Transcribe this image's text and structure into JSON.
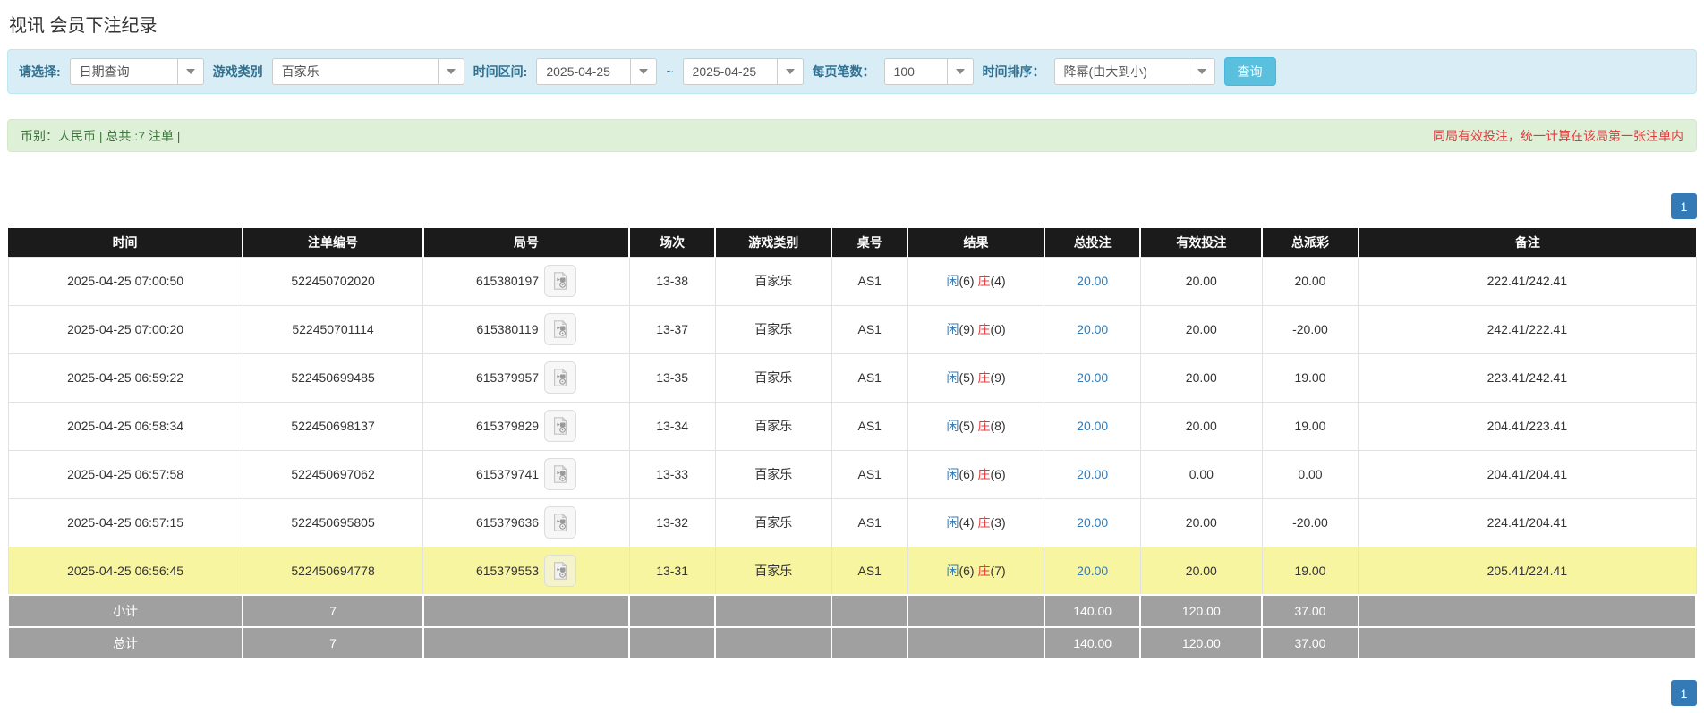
{
  "page": {
    "title": "视讯 会员下注纪录"
  },
  "filters": {
    "select_label": "请选择:",
    "select_value": "日期查询",
    "game_type_label": "游戏类别",
    "game_type_value": "百家乐",
    "time_range_label": "时间区间:",
    "date_from": "2025-04-25",
    "tilde": "~",
    "date_to": "2025-04-25",
    "per_page_label": "每页笔数：",
    "per_page_value": "100",
    "sort_label": "时间排序：",
    "sort_value": "降幂(由大到小)",
    "search_button": "查询"
  },
  "summary_bar": {
    "left_text": "币别：人民币 | 总共 :7 注单 |",
    "right_notice": "同局有效投注，统一计算在该局第一张注单内"
  },
  "pagination": {
    "page": "1"
  },
  "table": {
    "headers": [
      "时间",
      "注单编号",
      "局号",
      "场次",
      "游戏类别",
      "桌号",
      "结果",
      "总投注",
      "有效投注",
      "总派彩",
      "备注"
    ],
    "rows": [
      {
        "time": "2025-04-25 07:00:50",
        "bet_id": "522450702020",
        "round_id": "615380197",
        "session": "13-38",
        "game": "百家乐",
        "table_no": "AS1",
        "xian_label": "闲",
        "xian_score": "(6)",
        "zhuang_label": "庄",
        "zhuang_score": "(4)",
        "total_bet": "20.00",
        "valid_bet": "20.00",
        "payout": "20.00",
        "remark": "222.41/242.41",
        "highlight": false
      },
      {
        "time": "2025-04-25 07:00:20",
        "bet_id": "522450701114",
        "round_id": "615380119",
        "session": "13-37",
        "game": "百家乐",
        "table_no": "AS1",
        "xian_label": "闲",
        "xian_score": "(9)",
        "zhuang_label": "庄",
        "zhuang_score": "(0)",
        "total_bet": "20.00",
        "valid_bet": "20.00",
        "payout": "-20.00",
        "remark": "242.41/222.41",
        "highlight": false
      },
      {
        "time": "2025-04-25 06:59:22",
        "bet_id": "522450699485",
        "round_id": "615379957",
        "session": "13-35",
        "game": "百家乐",
        "table_no": "AS1",
        "xian_label": "闲",
        "xian_score": "(5)",
        "zhuang_label": "庄",
        "zhuang_score": "(9)",
        "total_bet": "20.00",
        "valid_bet": "20.00",
        "payout": "19.00",
        "remark": "223.41/242.41",
        "highlight": false
      },
      {
        "time": "2025-04-25 06:58:34",
        "bet_id": "522450698137",
        "round_id": "615379829",
        "session": "13-34",
        "game": "百家乐",
        "table_no": "AS1",
        "xian_label": "闲",
        "xian_score": "(5)",
        "zhuang_label": "庄",
        "zhuang_score": "(8)",
        "total_bet": "20.00",
        "valid_bet": "20.00",
        "payout": "19.00",
        "remark": "204.41/223.41",
        "highlight": false
      },
      {
        "time": "2025-04-25 06:57:58",
        "bet_id": "522450697062",
        "round_id": "615379741",
        "session": "13-33",
        "game": "百家乐",
        "table_no": "AS1",
        "xian_label": "闲",
        "xian_score": "(6)",
        "zhuang_label": "庄",
        "zhuang_score": "(6)",
        "total_bet": "20.00",
        "valid_bet": "0.00",
        "payout": "0.00",
        "remark": "204.41/204.41",
        "highlight": false
      },
      {
        "time": "2025-04-25 06:57:15",
        "bet_id": "522450695805",
        "round_id": "615379636",
        "session": "13-32",
        "game": "百家乐",
        "table_no": "AS1",
        "xian_label": "闲",
        "xian_score": "(4)",
        "zhuang_label": "庄",
        "zhuang_score": "(3)",
        "total_bet": "20.00",
        "valid_bet": "20.00",
        "payout": "-20.00",
        "remark": "224.41/204.41",
        "highlight": false
      },
      {
        "time": "2025-04-25 06:56:45",
        "bet_id": "522450694778",
        "round_id": "615379553",
        "session": "13-31",
        "game": "百家乐",
        "table_no": "AS1",
        "xian_label": "闲",
        "xian_score": "(6)",
        "zhuang_label": "庄",
        "zhuang_score": "(7)",
        "total_bet": "20.00",
        "valid_bet": "20.00",
        "payout": "19.00",
        "remark": "205.41/224.41",
        "highlight": true
      }
    ],
    "subtotal": {
      "label": "小计",
      "count": "7",
      "total_bet": "140.00",
      "valid_bet": "120.00",
      "payout": "37.00"
    },
    "total": {
      "label": "总计",
      "count": "7",
      "total_bet": "140.00",
      "valid_bet": "120.00",
      "payout": "37.00"
    }
  },
  "colors": {
    "accent_blue": "#337ab7",
    "search_button_bg": "#5bc0de",
    "filter_bar_bg": "#d9edf7",
    "summary_bar_bg": "#dff0d8",
    "summary_bar_text": "#3c763d",
    "notice_red": "#e4393c",
    "table_header_bg": "#1b1b1b",
    "highlight_row_bg": "#f8f5a0",
    "summary_row_bg": "#a0a0a0",
    "player_blue": "#337ab7",
    "banker_red": "#e4393c"
  }
}
